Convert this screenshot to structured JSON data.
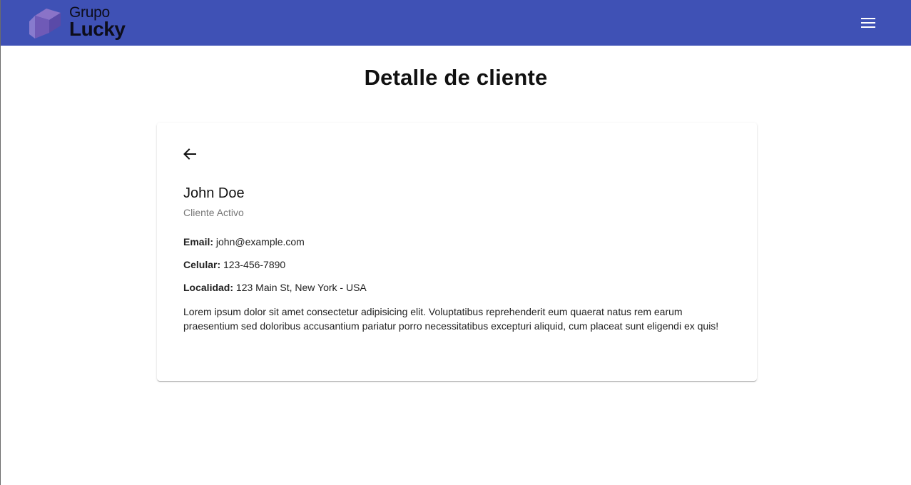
{
  "header": {
    "brand_top": "Grupo",
    "brand_bottom": "Lucky",
    "menu_icon": "hamburger-menu-icon",
    "bg_color": "#3f51b5"
  },
  "page": {
    "title": "Detalle de cliente"
  },
  "client": {
    "back_icon": "arrow-left-icon",
    "name": "John Doe",
    "status": "Cliente Activo",
    "email_label": "Email:",
    "email": "john@example.com",
    "phone_label": "Celular:",
    "phone": "123-456-7890",
    "location_label": "Localidad:",
    "location": "123 Main St, New York - USA",
    "description": "Lorem ipsum dolor sit amet consectetur adipisicing elit. Voluptatibus reprehenderit eum quaerat natus rem earum praesentium sed doloribus accusantium pariatur porro necessitatibus excepturi aliquid, cum placeat sunt eligendi ex quis!"
  }
}
